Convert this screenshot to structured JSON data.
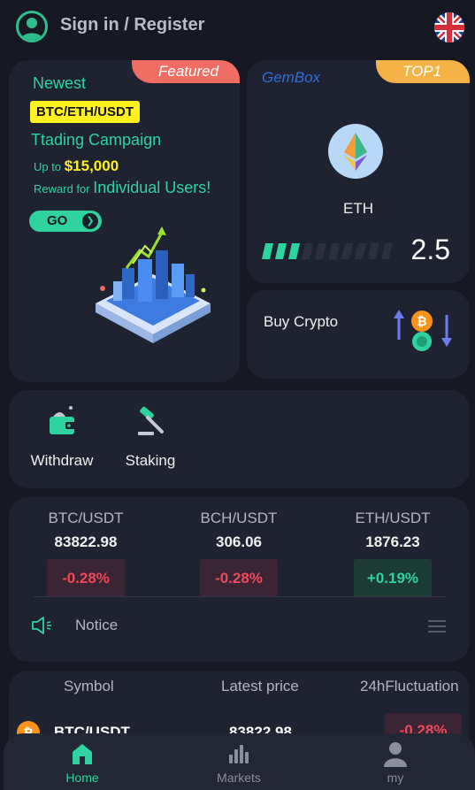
{
  "header": {
    "signin_label": "Sign in / Register",
    "language_icon": "uk-flag-icon",
    "avatar_icon": "user-avatar-icon"
  },
  "campaign": {
    "featured_tag": "Featured",
    "newest": "Newest",
    "pairs_badge": "BTC/ETH/USDT",
    "title": "Ttading Campaign",
    "upto_prefix": "Up to",
    "upto_amount": "$15,000",
    "reward_prefix": "Reward for",
    "reward_target": "Individual Users!",
    "go_label": "GO",
    "go_arrow": "❯"
  },
  "gembox": {
    "title": "GemBox",
    "tag": "TOP1",
    "coin_label": "ETH",
    "score": "2.5",
    "meter_filled": 3,
    "meter_total": 10
  },
  "buy_crypto": {
    "label": "Buy Crypto"
  },
  "quick_actions": [
    {
      "label": "Withdraw",
      "icon": "wallet-icon"
    },
    {
      "label": "Staking",
      "icon": "gavel-icon"
    }
  ],
  "tickers": [
    {
      "pair": "BTC/USDT",
      "price": "83822.98",
      "change": "-0.28%",
      "direction": "down"
    },
    {
      "pair": "BCH/USDT",
      "price": "306.06",
      "change": "-0.28%",
      "direction": "down"
    },
    {
      "pair": "ETH/USDT",
      "price": "1876.23",
      "change": "+0.19%",
      "direction": "up"
    }
  ],
  "notice": {
    "label": "Notice"
  },
  "market_table": {
    "headers": [
      "Symbol",
      "Latest price",
      "24hFluctuation"
    ],
    "rows": [
      {
        "symbol": "BTC/USDT",
        "price": "83822.98",
        "change": "-0.28%"
      }
    ]
  },
  "bottom_nav": [
    {
      "label": "Home",
      "icon": "home-icon",
      "active": true
    },
    {
      "label": "Markets",
      "icon": "bar-chart-icon",
      "active": false
    },
    {
      "label": "my",
      "icon": "profile-icon",
      "active": false
    }
  ],
  "colors": {
    "background": "#161823",
    "card": "#1f2230",
    "accent_green": "#2fd3a0",
    "down_red": "#ef4a5b",
    "featured": "#ef6d62",
    "top1": "#f5b347",
    "highlight_yellow": "#fff21f"
  }
}
